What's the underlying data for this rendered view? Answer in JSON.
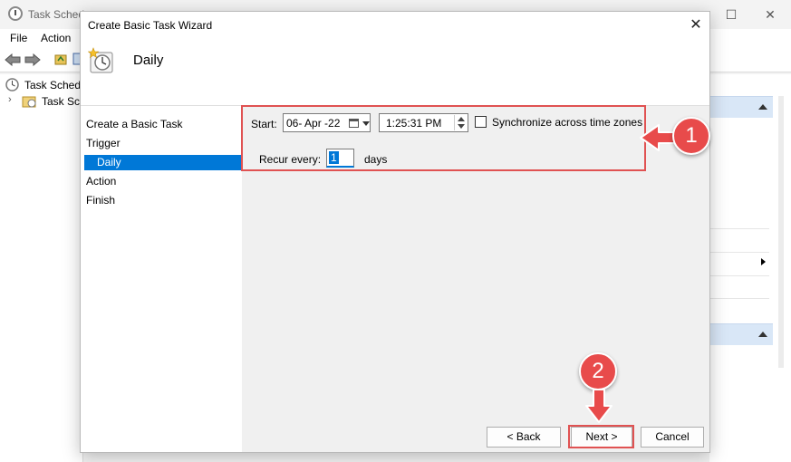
{
  "bg_window": {
    "title": "Task Schedu",
    "menu": [
      "File",
      "Action"
    ],
    "tree": [
      "Task Schedu",
      "Task Sch"
    ]
  },
  "dialog": {
    "title": "Create Basic Task Wizard",
    "close_glyph": "✕",
    "header_title": "Daily",
    "nav": [
      "Create a Basic Task",
      "Trigger",
      "Daily",
      "Action",
      "Finish"
    ],
    "form": {
      "start_label": "Start:",
      "start_date": "06- Apr -22",
      "start_time": "1:25:31 PM",
      "sync_label": "Synchronize across time zones",
      "sync_checked": false,
      "recur_label": "Recur every:",
      "recur_value": "1",
      "recur_unit": "days"
    },
    "buttons": {
      "back": "< Back",
      "next": "Next >",
      "cancel": "Cancel"
    }
  },
  "annotations": {
    "step1": "1",
    "step2": "2",
    "accent_color": "#e84b4b",
    "selection_color": "#0078d7"
  }
}
